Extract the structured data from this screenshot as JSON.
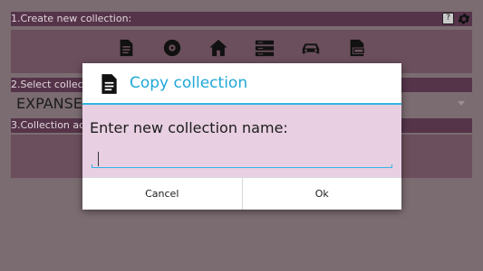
{
  "sections": {
    "create_label": "1.Create new collection:",
    "select_label": "2.Select collect",
    "actions_label": "3.Collection act"
  },
  "help_label": "?",
  "selected_collection": "EXPANSE",
  "collection_icons": [
    "document-icon",
    "disc-icon",
    "home-icon",
    "books-icon",
    "car-icon",
    "database-icon"
  ],
  "dialog": {
    "title": "Copy collection",
    "prompt": "Enter new collection name:",
    "input_value": "",
    "cancel_label": "Cancel",
    "ok_label": "Ok"
  },
  "colors": {
    "accent": "#34b5e5",
    "title_text": "#1fa8d8",
    "dialog_body": "#e8cfe2",
    "header_bar": "#55344a",
    "panel": "#6b4f5c",
    "backdrop": "#7b6c71"
  }
}
